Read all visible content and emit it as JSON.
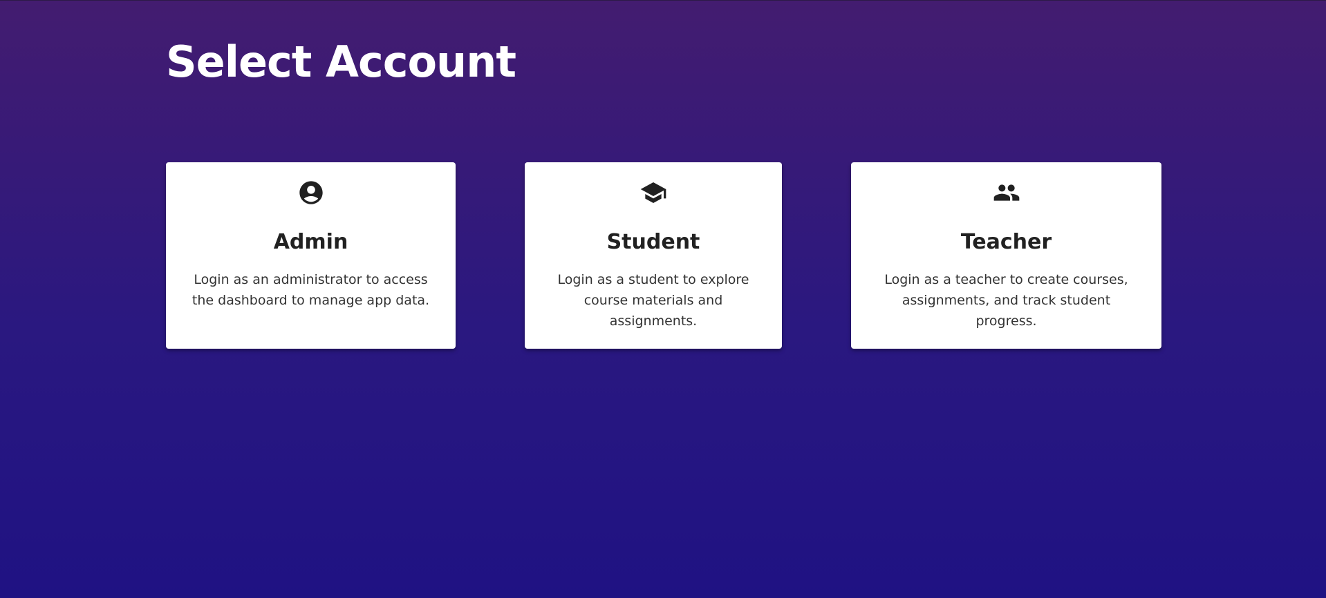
{
  "page": {
    "title": "Select Account"
  },
  "accounts": [
    {
      "title": "Admin",
      "description": "Login as an administrator to access the dashboard to manage app data.",
      "icon": "account-circle-icon"
    },
    {
      "title": "Student",
      "description": "Login as a student to explore course materials and assignments.",
      "icon": "graduation-cap-icon"
    },
    {
      "title": "Teacher",
      "description": "Login as a teacher to create courses, assignments, and track student progress.",
      "icon": "people-icon"
    }
  ],
  "colors": {
    "background_top": "#431c70",
    "background_bottom": "#1f1283",
    "card": "#ffffff",
    "heading_text": "#ffffff",
    "card_title": "#212121",
    "card_text": "#333333"
  }
}
